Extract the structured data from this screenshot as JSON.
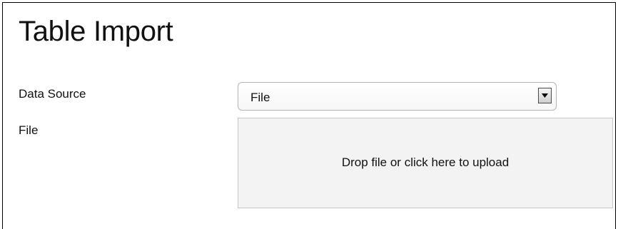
{
  "page": {
    "title": "Table Import"
  },
  "form": {
    "data_source_label": "Data Source",
    "data_source_value": "File",
    "file_label": "File",
    "dropzone_text": "Drop file or click here to upload"
  },
  "icons": {
    "dropdown": "chevron-down-icon"
  },
  "colors": {
    "dropzone_background": "#f3f3f3",
    "border": "#b5b5b5",
    "text": "#111111"
  }
}
